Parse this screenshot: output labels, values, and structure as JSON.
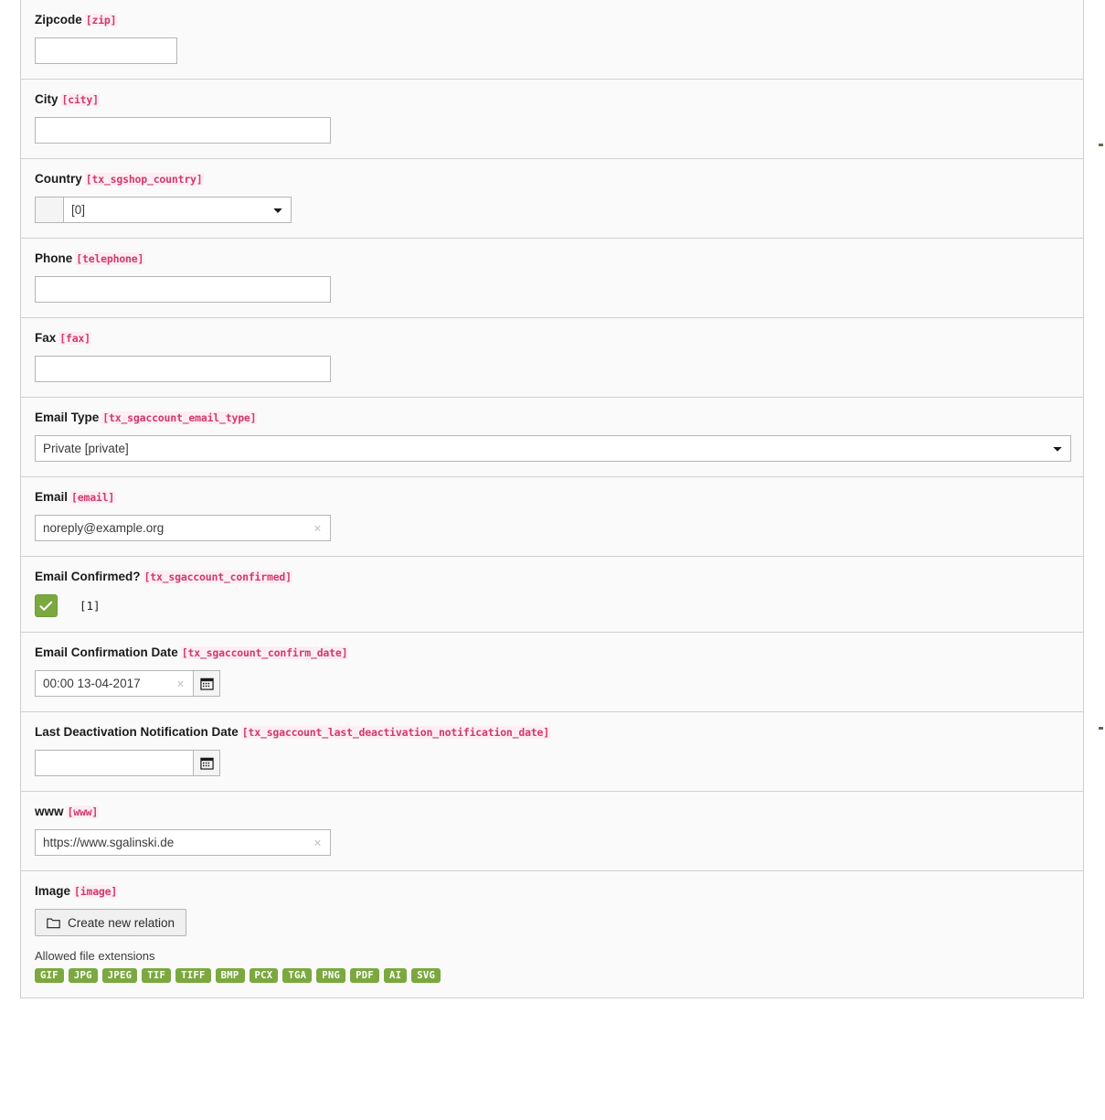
{
  "form": {
    "fields": [
      {
        "id": "zipcode",
        "label": "Zipcode",
        "key": "[zip]",
        "type": "text",
        "value": "",
        "width": "small"
      },
      {
        "id": "city",
        "label": "City",
        "key": "[city]",
        "type": "text",
        "value": "",
        "width": "medium"
      },
      {
        "id": "country",
        "label": "Country",
        "key": "[tx_sgshop_country]",
        "type": "select-group",
        "value": "[0]",
        "options": [
          "[0]"
        ]
      },
      {
        "id": "phone",
        "label": "Phone",
        "key": "[telephone]",
        "type": "text",
        "value": "",
        "width": "medium"
      },
      {
        "id": "fax",
        "label": "Fax",
        "key": "[fax]",
        "type": "text",
        "value": "",
        "width": "medium"
      },
      {
        "id": "email-type",
        "label": "Email Type",
        "key": "[tx_sgaccount_email_type]",
        "type": "select",
        "value": "Private [private]",
        "options": [
          "Private [private]"
        ]
      },
      {
        "id": "email",
        "label": "Email",
        "key": "[email]",
        "type": "text-clear",
        "value": "noreply@example.org",
        "clear_label": "×"
      },
      {
        "id": "email-confirmed",
        "label": "Email Confirmed?",
        "key": "[tx_sgaccount_confirmed]",
        "type": "checkbox",
        "checked": true,
        "value": "[1]"
      },
      {
        "id": "email-confirmation-date",
        "label": "Email Confirmation Date",
        "key": "[tx_sgaccount_confirm_date]",
        "type": "date",
        "value": "00:00 13-04-2017",
        "clear_label": "×"
      },
      {
        "id": "last-deactivation-notification-date",
        "label": "Last Deactivation Notification Date",
        "key": "[tx_sgaccount_last_deactivation_notification_date]",
        "type": "date",
        "value": "",
        "clear_label": ""
      },
      {
        "id": "www",
        "label": "www",
        "key": "[www]",
        "type": "text-clear",
        "value": "https://www.sgalinski.de",
        "clear_label": "×"
      },
      {
        "id": "image",
        "label": "Image",
        "key": "[image]",
        "type": "relation",
        "button_label": "Create new relation",
        "extensions_caption": "Allowed file extensions",
        "extensions": [
          "GIF",
          "JPG",
          "JPEG",
          "TIF",
          "TIFF",
          "BMP",
          "PCX",
          "TGA",
          "PNG",
          "PDF",
          "AI",
          "SVG"
        ]
      }
    ]
  },
  "colors": {
    "row_background": "#fafafa",
    "field_key": "#d1396c",
    "field_key_background": "#fdeef3",
    "accent_green": "#7ba83f",
    "border": "#d0d0d0",
    "input_border": "#b5b5b5"
  }
}
